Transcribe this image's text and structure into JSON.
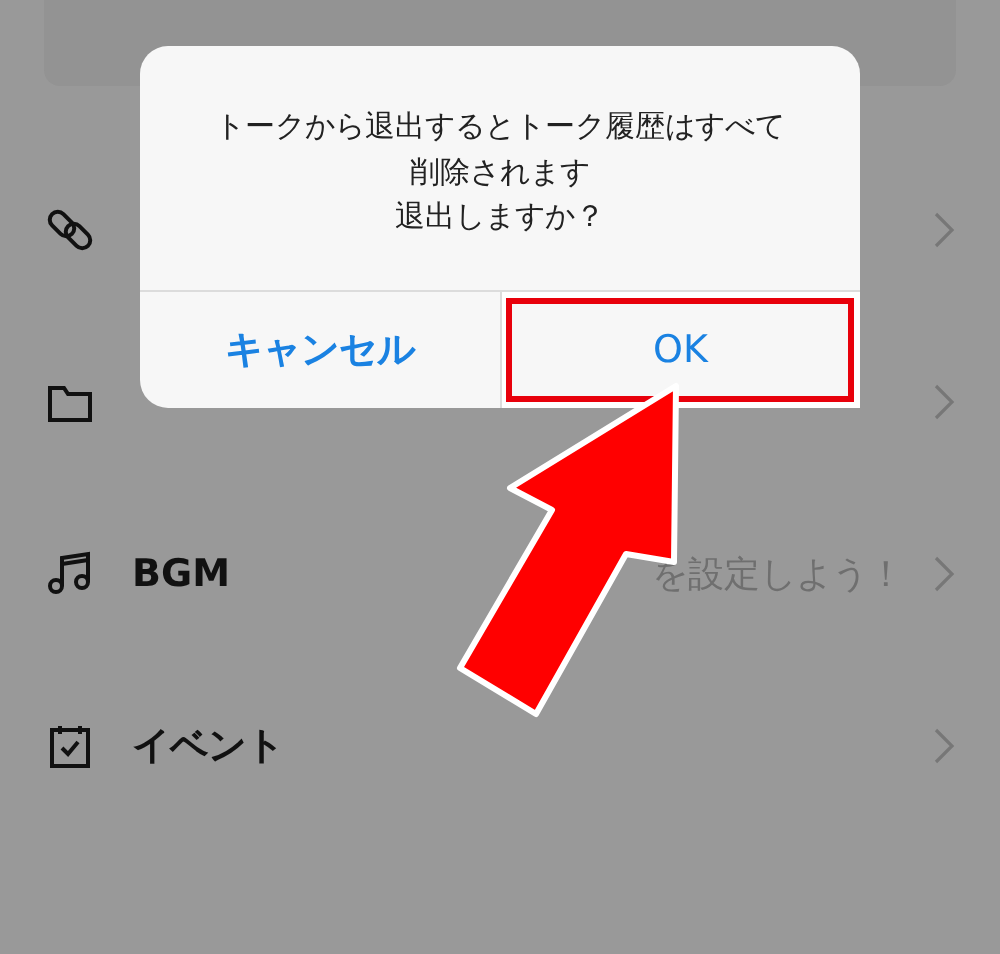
{
  "rows": [
    {
      "kind": "link"
    },
    {
      "kind": "folder"
    },
    {
      "kind": "music",
      "label": "BGM",
      "value": "を設定しよう！"
    },
    {
      "kind": "calendar",
      "label": "イベント"
    }
  ],
  "dialog": {
    "message": [
      "トークから退出するとトーク履歴はすべて",
      "削除されます",
      "退出しますか？"
    ],
    "buttons": [
      {
        "label": "キャンセル",
        "kind": "cancel",
        "highlighted": false
      },
      {
        "label": "OK",
        "kind": "default",
        "highlighted": true
      }
    ]
  },
  "callout_arrow": true
}
